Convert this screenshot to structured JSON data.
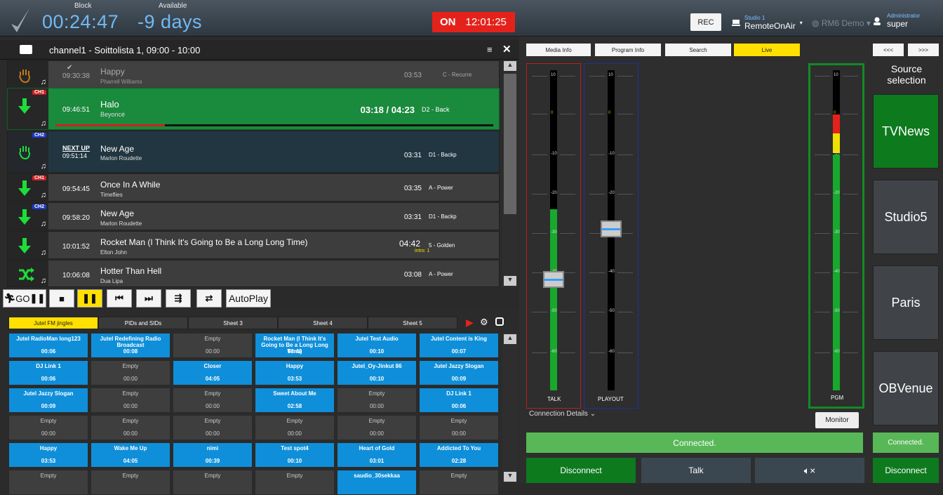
{
  "header": {
    "block_label": "Block",
    "block_time": "00:24:47",
    "available_label": "Available",
    "available_value": "-9 days",
    "on_label": "ON",
    "clock": "12:01:25",
    "rec_label": "REC",
    "studio_small": "Studio 1",
    "studio_name": "RemoteOnAir",
    "rm6": "RM6 Demo",
    "admin_small": "Administrator",
    "admin_name": "super"
  },
  "playlist": {
    "title": "channel1 - Soittolista 1, 09:00 - 10:00",
    "rows": [
      {
        "time": "09:30:38",
        "title": "Happy",
        "artist": "Pharrell Williams",
        "dur": "03:53",
        "cat": "C - Recurre"
      },
      {
        "time": "09:46:51",
        "title": "Halo",
        "artist": "Beyoncé",
        "dur": "03:18 / 04:23",
        "cat": "D2 - Back",
        "badge": "CH1"
      },
      {
        "next": "NEXT UP",
        "time": "09:51:14",
        "title": "New Age",
        "artist": "Marlon Roudette",
        "dur": "03:31",
        "cat": "D1 - Backp",
        "badge": "CH2"
      },
      {
        "time": "09:54:45",
        "title": "Once In A While",
        "artist": "Timeflies",
        "dur": "03:35",
        "cat": "A - Power",
        "badge": "CH1"
      },
      {
        "time": "09:58:20",
        "title": "New Age",
        "artist": "Marlon Roudette",
        "dur": "03:31",
        "cat": "D1 - Backp",
        "badge": "CH2"
      },
      {
        "time": "10:01:52",
        "title": "Rocket Man (I Think It's Going to Be a Long Long Time)",
        "artist": "Elton John",
        "dur": "04:42",
        "intro": "intro: 1",
        "cat": "5 - Golden"
      },
      {
        "time": "10:06:08",
        "title": "Hotter Than Hell",
        "artist": "Dua Lipa",
        "dur": "03:08",
        "cat": "A - Power"
      }
    ]
  },
  "transport": {
    "go": "GO",
    "autoplay": "AutoPlay"
  },
  "jingles": {
    "tabs": [
      "Jutel FM jingles",
      "PIDs and SIDs",
      "Sheet 3",
      "Sheet 4",
      "Sheet 5"
    ],
    "cells": [
      [
        "Jutel RadioMan long123",
        "00:06",
        "b"
      ],
      [
        "Jutel Redefining Radio Broadcast",
        "00:08",
        "b"
      ],
      [
        "Empty",
        "00:00",
        "g"
      ],
      [
        "Rocket Man (I Think It's Going to Be a Long Long Time)",
        "04:42",
        "b"
      ],
      [
        "Jutel Test Audio",
        "00:10",
        "b"
      ],
      [
        "Jutel Content is King",
        "00:07",
        "b"
      ],
      [
        "DJ Link 1",
        "00:06",
        "b"
      ],
      [
        "Empty",
        "00:00",
        "g"
      ],
      [
        "Closer",
        "04:05",
        "b"
      ],
      [
        "Happy",
        "03:53",
        "b"
      ],
      [
        "Jutel_Oy-Jinkut 86",
        "00:10",
        "b"
      ],
      [
        "Jutel Jazzy Slogan",
        "00:09",
        "b"
      ],
      [
        "Jutel Jazzy Slogan",
        "00:09",
        "b"
      ],
      [
        "Empty",
        "00:00",
        "g"
      ],
      [
        "Empty",
        "00:00",
        "g"
      ],
      [
        "Sweet About Me",
        "02:58",
        "b"
      ],
      [
        "Empty",
        "00:00",
        "g"
      ],
      [
        "DJ Link 1",
        "00:06",
        "b"
      ],
      [
        "Empty",
        "00:00",
        "g"
      ],
      [
        "Empty",
        "00:00",
        "g"
      ],
      [
        "Empty",
        "00:00",
        "g"
      ],
      [
        "Empty",
        "00:00",
        "g"
      ],
      [
        "Empty",
        "00:00",
        "g"
      ],
      [
        "Empty",
        "00:00",
        "g"
      ],
      [
        "Happy",
        "03:53",
        "b"
      ],
      [
        "Wake Me Up",
        "04:05",
        "b"
      ],
      [
        "nimi",
        "00:39",
        "b"
      ],
      [
        "Test spot4",
        "00:10",
        "b"
      ],
      [
        "Heart of Gold",
        "03:01",
        "b"
      ],
      [
        "Addicted To You",
        "02:28",
        "b"
      ],
      [
        "Empty",
        "",
        "g"
      ],
      [
        "Empty",
        "",
        "g"
      ],
      [
        "Empty",
        "",
        "g"
      ],
      [
        "Empty",
        "",
        "g"
      ],
      [
        "saudio_30sekkaa",
        "",
        "b"
      ],
      [
        "Empty",
        "",
        "g"
      ]
    ]
  },
  "right": {
    "tabs": [
      "Media Info",
      "Program Info",
      "Search",
      "Live"
    ],
    "nav_prev": "<<<",
    "nav_next": ">>>",
    "meters": {
      "talk": "TALK",
      "playout": "PLAYOUT",
      "pgm": "PGM"
    },
    "ticks": [
      "10",
      "0",
      "-10",
      "-20",
      "-30",
      "-40",
      "-50",
      "-60"
    ],
    "connection_details": "Connection Details",
    "monitor": "Monitor",
    "status": "Connected.",
    "disconnect": "Disconnect",
    "talk": "Talk",
    "source_title": "Source selection",
    "sources": [
      "TVNews",
      "Studio5",
      "Paris",
      "OBVenue"
    ],
    "source_status": "Connected.",
    "source_disconnect": "Disconnect"
  },
  "colors": {
    "accent": "#0f8fd9",
    "live": "#ffe000",
    "onair": "#e4221b",
    "green": "#0d7a1e"
  }
}
